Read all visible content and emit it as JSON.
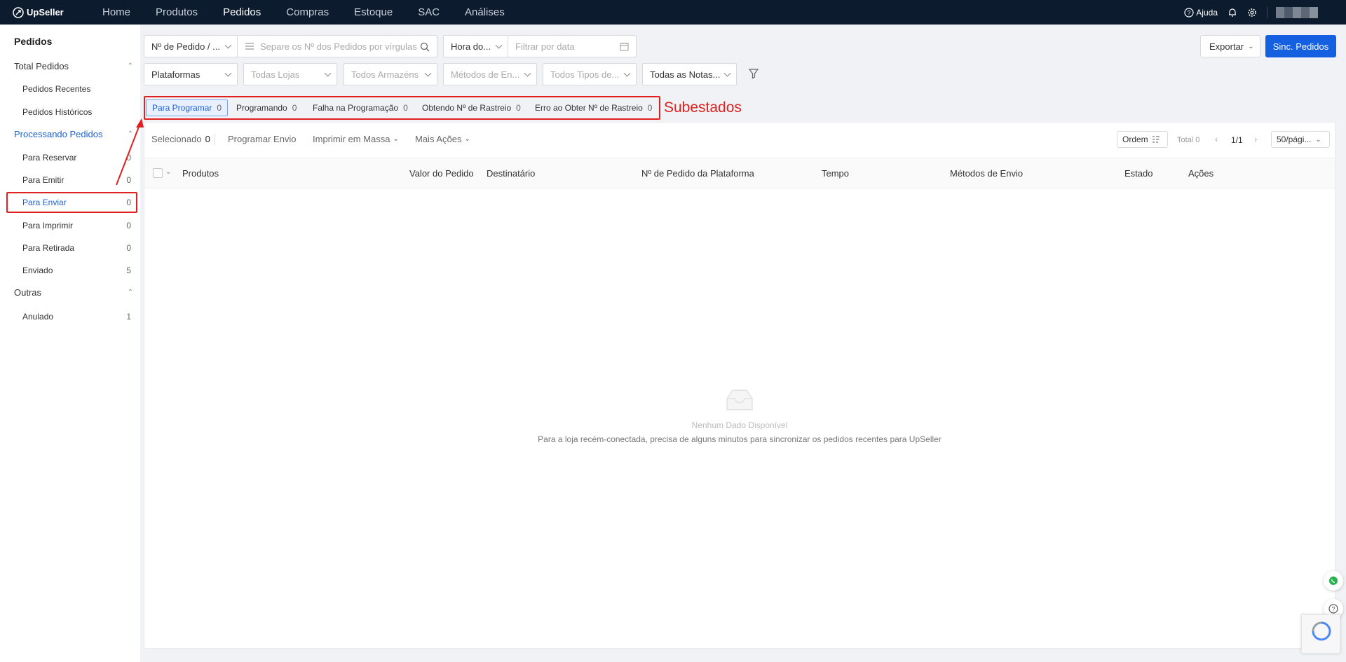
{
  "brand": "UpSeller",
  "nav": [
    "Home",
    "Produtos",
    "Pedidos",
    "Compras",
    "Estoque",
    "SAC",
    "Análises"
  ],
  "nav_active": "Pedidos",
  "topright": {
    "help": "Ajuda"
  },
  "sidebar": {
    "title": "Pedidos",
    "groups": {
      "total": "Total Pedidos",
      "processing": "Processando Pedidos",
      "others": "Outras"
    },
    "items": {
      "recent": {
        "label": "Pedidos Recentes"
      },
      "history": {
        "label": "Pedidos Históricos"
      },
      "reserve": {
        "label": "Para Reservar",
        "count": "0"
      },
      "emit": {
        "label": "Para Emitir",
        "count": "0"
      },
      "ship": {
        "label": "Para Enviar",
        "count": "0"
      },
      "print": {
        "label": "Para Imprimir",
        "count": "0"
      },
      "pickup": {
        "label": "Para Retirada",
        "count": "0"
      },
      "sent": {
        "label": "Enviado",
        "count": "5"
      },
      "cancelled": {
        "label": "Anulado",
        "count": "1"
      }
    }
  },
  "filters": {
    "order_type": "Nº de Pedido / ...",
    "search_placeholder": "Separe os Nº dos Pedidos por vírgulas",
    "time_type": "Hora do...",
    "date_placeholder": "Filtrar por data",
    "platforms": "Plataformas",
    "stores": "Todas Lojas",
    "warehouses": "Todos Armazéns",
    "shipping": "Métodos de En...",
    "types": "Todos Tipos de...",
    "notes": "Todas as Notas..."
  },
  "buttons": {
    "export": "Exportar",
    "sync": "Sinc. Pedidos"
  },
  "annotation": "Subestados",
  "tabs": [
    {
      "label": "Para Programar",
      "count": "0"
    },
    {
      "label": "Programando",
      "count": "0"
    },
    {
      "label": "Falha na Programação",
      "count": "0"
    },
    {
      "label": "Obtendo Nº de Rastreio",
      "count": "0"
    },
    {
      "label": "Erro ao Obter Nº de Rastreio",
      "count": "0"
    }
  ],
  "actions": {
    "selected_label": "Selecionado",
    "selected_count": "0",
    "schedule": "Programar Envio",
    "bulk_print": "Imprimir em Massa",
    "more": "Mais Ações",
    "order": "Ordem",
    "total": "Total 0",
    "page": "1/1",
    "page_size": "50/pági..."
  },
  "columns": [
    "Produtos",
    "Valor do Pedido",
    "Destinatário",
    "Nº de Pedido da Plataforma",
    "Tempo",
    "Métodos de Envio",
    "Estado",
    "Ações"
  ],
  "empty": {
    "title": "Nenhum Dado Disponível",
    "desc": "Para a loja recém-conectada, precisa de alguns minutos para sincronizar os pedidos recentes para UpSeller"
  },
  "colors": {
    "topbar": "#0d1b2e",
    "primary": "#1460e0",
    "annotation": "#e02020"
  }
}
